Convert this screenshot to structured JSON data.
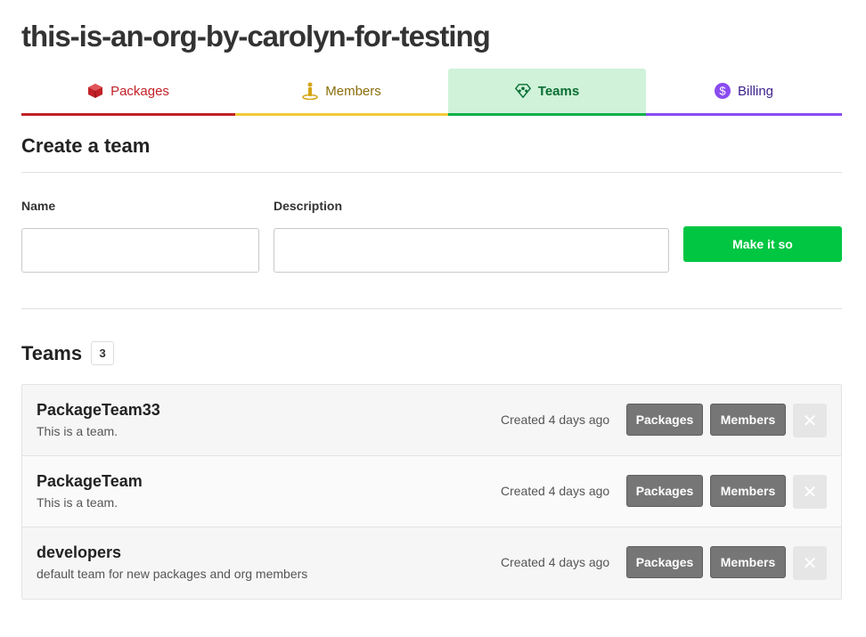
{
  "org": {
    "title": "this-is-an-org-by-carolyn-for-testing"
  },
  "tabs": [
    {
      "label": "Packages",
      "icon": "package-icon",
      "color": "#c12127"
    },
    {
      "label": "Members",
      "icon": "members-icon",
      "color": "#8a6d0b"
    },
    {
      "label": "Teams",
      "icon": "teams-icon",
      "color": "#0b6e33",
      "active": true
    },
    {
      "label": "Billing",
      "icon": "billing-icon",
      "color": "#3b1f8c"
    }
  ],
  "create": {
    "title": "Create a team",
    "name_label": "Name",
    "name_value": "",
    "description_label": "Description",
    "description_value": "",
    "submit_label": "Make it so"
  },
  "teams": {
    "heading": "Teams",
    "count": "3",
    "rows": [
      {
        "name": "PackageTeam33",
        "description": "This is a team.",
        "created": "Created 4 days ago",
        "packages_label": "Packages",
        "members_label": "Members"
      },
      {
        "name": "PackageTeam",
        "description": "This is a team.",
        "created": "Created 4 days ago",
        "packages_label": "Packages",
        "members_label": "Members"
      },
      {
        "name": "developers",
        "description": "default team for new packages and org members",
        "created": "Created 4 days ago",
        "packages_label": "Packages",
        "members_label": "Members"
      }
    ]
  },
  "colors": {
    "accent_green": "#00c642",
    "packages_red": "#c12127",
    "members_yellow": "#f2cb3a",
    "teams_green": "#0ab04a",
    "billing_purple": "#8a4bf0"
  }
}
